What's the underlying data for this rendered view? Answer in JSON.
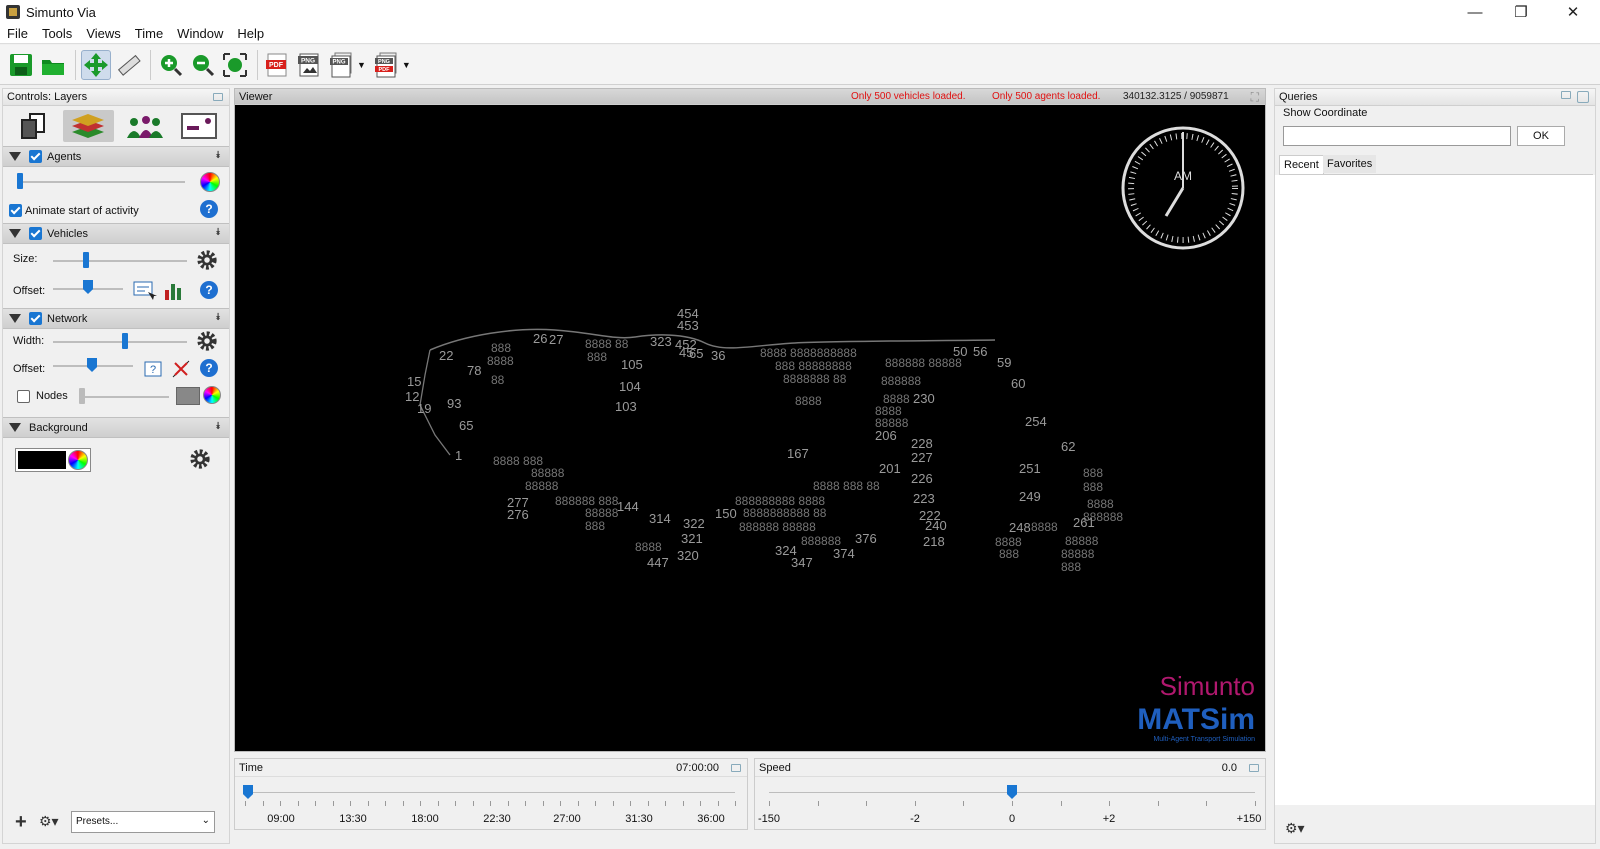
{
  "window": {
    "title": "Simunto Via",
    "minimize": "—",
    "restore": "❐",
    "close": "✕"
  },
  "menu": [
    "File",
    "Tools",
    "Views",
    "Time",
    "Window",
    "Help"
  ],
  "toolbar": {
    "icons": [
      "save-icon",
      "open-folder-icon",
      "pan-icon",
      "ruler-icon",
      "zoom-in-icon",
      "zoom-out-icon",
      "zoom-fit-icon",
      "export-pdf-icon",
      "export-png-icon",
      "export-png-series-icon",
      "export-png-pdf-icon"
    ],
    "export_pdf": "PDF",
    "export_png": "PNG"
  },
  "controls": {
    "title": "Controls: Layers",
    "agents": {
      "label": "Agents",
      "animate_label": "Animate start of activity"
    },
    "vehicles": {
      "label": "Vehicles",
      "size_label": "Size:",
      "offset_label": "Offset:"
    },
    "network": {
      "label": "Network",
      "width_label": "Width:",
      "offset_label": "Offset:",
      "nodes_label": "Nodes"
    },
    "background": {
      "label": "Background",
      "color": "#000000"
    },
    "presets_placeholder": "Presets..."
  },
  "viewer": {
    "title": "Viewer",
    "warning_vehicles": "Only 500 vehicles loaded.",
    "warning_agents": "Only 500 agents loaded.",
    "coordinates": "340132.3125 / 9059871",
    "clock_label": "AM",
    "brand_top": "Simunto",
    "brand_main": "MATSim",
    "brand_sub": "Multi-Agent Transport Simulation",
    "node_labels": [
      "454",
      "453",
      "26",
      "27",
      "323",
      "452",
      "45",
      "65",
      "36",
      "105",
      "104",
      "103",
      "22",
      "78",
      "15",
      "12",
      "19",
      "93",
      "65",
      "1",
      "167",
      "206",
      "228",
      "227",
      "201",
      "226",
      "223",
      "218",
      "62",
      "254",
      "251",
      "249",
      "261",
      "248",
      "60",
      "59",
      "50",
      "230",
      "277",
      "276",
      "144",
      "314",
      "322",
      "321",
      "320",
      "447",
      "324",
      "347",
      "374",
      "376",
      "222",
      "240",
      "150",
      "56"
    ]
  },
  "queries": {
    "title": "Queries",
    "show_coordinate": "Show Coordinate",
    "ok": "OK",
    "tab_recent": "Recent",
    "tab_favorites": "Favorites"
  },
  "time": {
    "label": "Time",
    "value": "07:00:00",
    "ticks": [
      "09:00",
      "13:30",
      "18:00",
      "22:30",
      "27:00",
      "31:30",
      "36:00"
    ]
  },
  "speed": {
    "label": "Speed",
    "value": "0.0",
    "ticks": [
      "-150",
      "-2",
      "0",
      "+2",
      "+150"
    ]
  }
}
